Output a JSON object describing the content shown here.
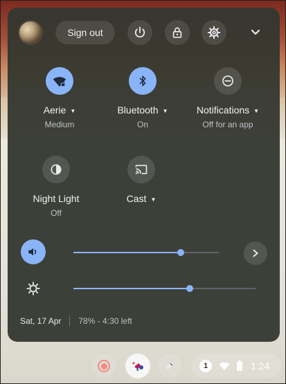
{
  "header": {
    "sign_out_label": "Sign out"
  },
  "tiles": [
    {
      "label": "Aerie",
      "sublabel": "Medium",
      "icon": "wifi-lock-icon",
      "active": true
    },
    {
      "label": "Bluetooth",
      "sublabel": "On",
      "icon": "bluetooth-icon",
      "active": true
    },
    {
      "label": "Notifications",
      "sublabel": "Off for an app",
      "icon": "do-not-disturb-icon",
      "active": false
    },
    {
      "label": "Night Light",
      "sublabel": "Off",
      "icon": "night-light-icon",
      "active": false
    },
    {
      "label": "Cast",
      "sublabel": "",
      "icon": "cast-icon",
      "active": false
    }
  ],
  "sliders": {
    "volume_fraction": 0.74,
    "brightness_fraction": 0.64
  },
  "footer": {
    "date": "Sat, 17 Apr",
    "battery": "78% - 4:30 left"
  },
  "shelf": {
    "notification_count": "1",
    "time": "1:24"
  },
  "colors": {
    "accent": "#8ab4f8",
    "panel_bg": "#34372f",
    "record": "#f28b82"
  }
}
